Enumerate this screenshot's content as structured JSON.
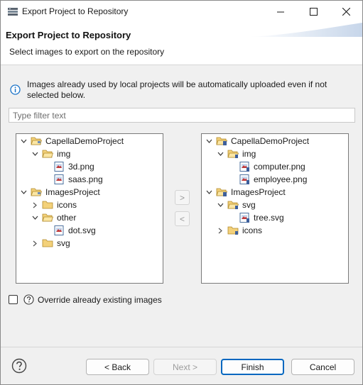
{
  "window": {
    "title": "Export Project to Repository"
  },
  "header": {
    "title": "Export Project to Repository",
    "subtitle": "Select images to export on the repository"
  },
  "info": {
    "text": "Images already used by local projects will be automatically uploaded even if not selected below."
  },
  "filter": {
    "placeholder": "Type filter text",
    "value": ""
  },
  "left_tree": {
    "items": [
      {
        "label": "CapellaDemoProject",
        "kind": "project",
        "expanded": true
      },
      {
        "label": "img",
        "kind": "folder",
        "expanded": true
      },
      {
        "label": "3d.png",
        "kind": "image"
      },
      {
        "label": "saas.png",
        "kind": "image"
      },
      {
        "label": "ImagesProject",
        "kind": "project",
        "expanded": true
      },
      {
        "label": "icons",
        "kind": "folder",
        "expanded": false
      },
      {
        "label": "other",
        "kind": "folder",
        "expanded": true
      },
      {
        "label": "dot.svg",
        "kind": "image"
      },
      {
        "label": "svg",
        "kind": "folder",
        "expanded": false
      }
    ]
  },
  "right_tree": {
    "items": [
      {
        "label": "CapellaDemoProject",
        "kind": "project-remote",
        "expanded": true
      },
      {
        "label": "img",
        "kind": "folder-remote",
        "expanded": true
      },
      {
        "label": "computer.png",
        "kind": "image-remote"
      },
      {
        "label": "employee.png",
        "kind": "image-remote"
      },
      {
        "label": "ImagesProject",
        "kind": "project-remote",
        "expanded": true
      },
      {
        "label": "svg",
        "kind": "folder-remote",
        "expanded": true
      },
      {
        "label": "tree.svg",
        "kind": "image-remote"
      },
      {
        "label": "icons",
        "kind": "folder-remote",
        "expanded": false
      }
    ]
  },
  "move": {
    "add_label": ">",
    "remove_label": "<"
  },
  "override": {
    "label": "Override already existing images",
    "checked": false
  },
  "buttons": {
    "back": "< Back",
    "next": "Next >",
    "finish": "Finish",
    "cancel": "Cancel"
  },
  "colors": {
    "accent": "#0067c0",
    "folder": "#e8b84a",
    "info": "#1a73c8"
  }
}
